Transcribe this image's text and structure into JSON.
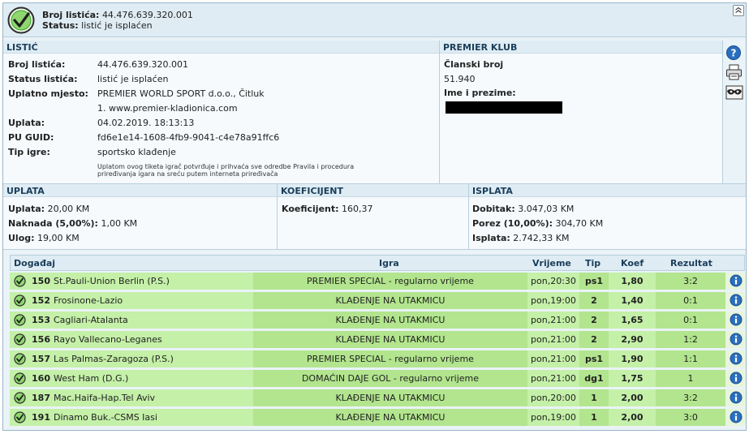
{
  "header": {
    "ticket_label": "Broj listića:",
    "ticket_value": "44.476.639.320.001",
    "status_label": "Status:",
    "status_value": "listić je isplaćen"
  },
  "listic": {
    "title": "LISTIĆ",
    "rows": [
      {
        "label": "Broj listića:",
        "value": "44.476.639.320.001"
      },
      {
        "label": "Status listića:",
        "value": "listić je isplaćen"
      },
      {
        "label": "Uplatno mjesto:",
        "value": "PREMIER WORLD SPORT d.o.o., Čitluk"
      },
      {
        "label": "",
        "value": "1. www.premier-kladionica.com"
      },
      {
        "label": "Uplata:",
        "value": "04.02.2019. 18:13:13"
      },
      {
        "label": "PU GUID:",
        "value": "fd6e1e14-1608-4fb9-9041-c4e78a91ffc6"
      },
      {
        "label": "Tip igre:",
        "value": "sportsko klađenje"
      }
    ],
    "fine_print_1": "Uplatom ovog tiketa igrač potvrđuje i prihvaća sve odredbe Pravila i procedura",
    "fine_print_2": "priređivanja igara na sreću putem interneta priređivača"
  },
  "klub": {
    "title": "PREMIER KLUB",
    "member_label": "Članski broj",
    "member_value": "51.940",
    "name_label": "Ime i prezime:"
  },
  "uplata": {
    "title": "UPLATA",
    "rows": [
      {
        "label": "Uplata:",
        "value": "20,00 KM"
      },
      {
        "label": "Naknada (5,00%):",
        "value": "1,00 KM"
      },
      {
        "label": "Ulog:",
        "value": "19,00 KM"
      }
    ]
  },
  "koeficijent": {
    "title": "KOEFICIJENT",
    "label": "Koeficijent:",
    "value": "160,37"
  },
  "isplata": {
    "title": "ISPLATA",
    "rows": [
      {
        "label": "Dobitak:",
        "value": "3.047,03 KM"
      },
      {
        "label": "Porez (10,00%):",
        "value": "304,70 KM"
      },
      {
        "label": "Isplata:",
        "value": "2.742,33 KM"
      }
    ]
  },
  "table": {
    "headers": [
      "Događaj",
      "Igra",
      "Vrijeme",
      "Tip",
      "Koef",
      "Rezultat"
    ],
    "rows": [
      {
        "num": "150",
        "event": "St.Pauli-Union Berlin (P.S.)",
        "game": "PREMIER SPECIAL - regularno vrijeme",
        "time": "pon,20:30",
        "tip": "ps1",
        "koef": "1,80",
        "result": "3:2"
      },
      {
        "num": "152",
        "event": "Frosinone-Lazio",
        "game": "KLAĐENJE NA UTAKMICU",
        "time": "pon,19:00",
        "tip": "2",
        "koef": "1,40",
        "result": "0:1"
      },
      {
        "num": "153",
        "event": "Cagliari-Atalanta",
        "game": "KLAĐENJE NA UTAKMICU",
        "time": "pon,21:00",
        "tip": "2",
        "koef": "1,65",
        "result": "0:1"
      },
      {
        "num": "156",
        "event": "Rayo Vallecano-Leganes",
        "game": "KLAĐENJE NA UTAKMICU",
        "time": "pon,21:00",
        "tip": "2",
        "koef": "2,90",
        "result": "1:2"
      },
      {
        "num": "157",
        "event": "Las Palmas-Zaragoza (P.S.)",
        "game": "PREMIER SPECIAL - regularno vrijeme",
        "time": "pon,21:00",
        "tip": "ps1",
        "koef": "1,90",
        "result": "1:1"
      },
      {
        "num": "160",
        "event": "West Ham (D.G.)",
        "game": "DOMAĆIN DAJE GOL - regularno vrijeme",
        "time": "pon,21:00",
        "tip": "dg1",
        "koef": "1,75",
        "result": "1"
      },
      {
        "num": "187",
        "event": "Mac.Haifa-Hap.Tel Aviv",
        "game": "KLAĐENJE NA UTAKMICU",
        "time": "pon,20:00",
        "tip": "1",
        "koef": "2,00",
        "result": "3:2"
      },
      {
        "num": "191",
        "event": "Dinamo Buk.-CSMS Iasi",
        "game": "KLAĐENJE NA UTAKMICU",
        "time": "pon,19:00",
        "tip": "1",
        "koef": "2,00",
        "result": "3:0"
      }
    ]
  },
  "colors": {
    "status_ok": "#3aa02a",
    "row_light": "#c4f0a8",
    "row_dark": "#b2e58e",
    "info_blue": "#2a6fbf"
  }
}
